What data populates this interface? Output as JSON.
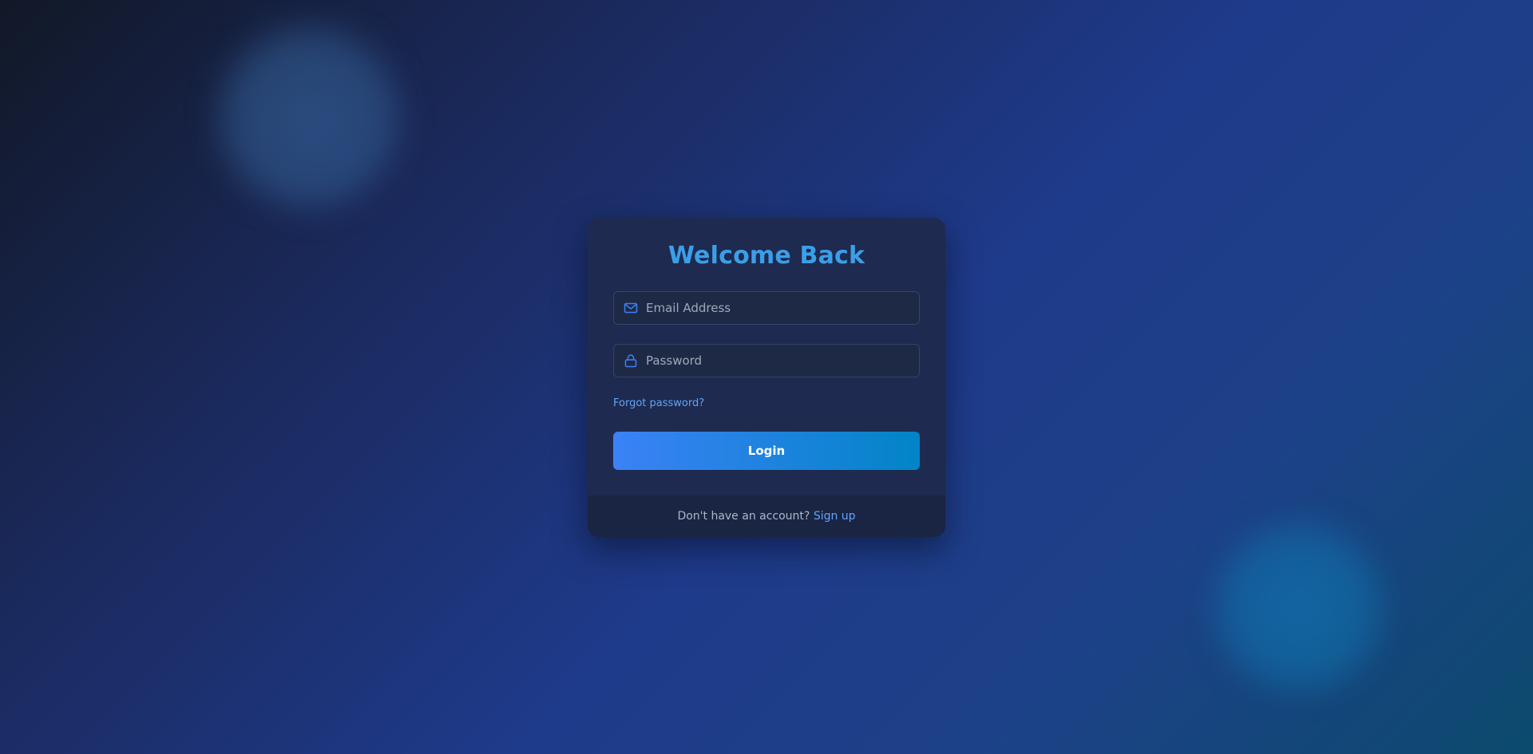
{
  "colors": {
    "accent": "#3b9fe8",
    "link": "#60a5fa",
    "button_gradient_start": "#3b82f6",
    "button_gradient_end": "#0284c7",
    "card_background": "#1e2a4f",
    "footer_background": "#1a2544"
  },
  "login": {
    "title": "Welcome Back",
    "email": {
      "icon": "mail-icon",
      "placeholder": "Email Address",
      "value": ""
    },
    "password": {
      "icon": "lock-icon",
      "placeholder": "Password",
      "value": ""
    },
    "forgot_password_label": "Forgot password?",
    "login_button_label": "Login"
  },
  "footer": {
    "prompt": "Don't have an account?",
    "signup_label": "Sign up"
  }
}
